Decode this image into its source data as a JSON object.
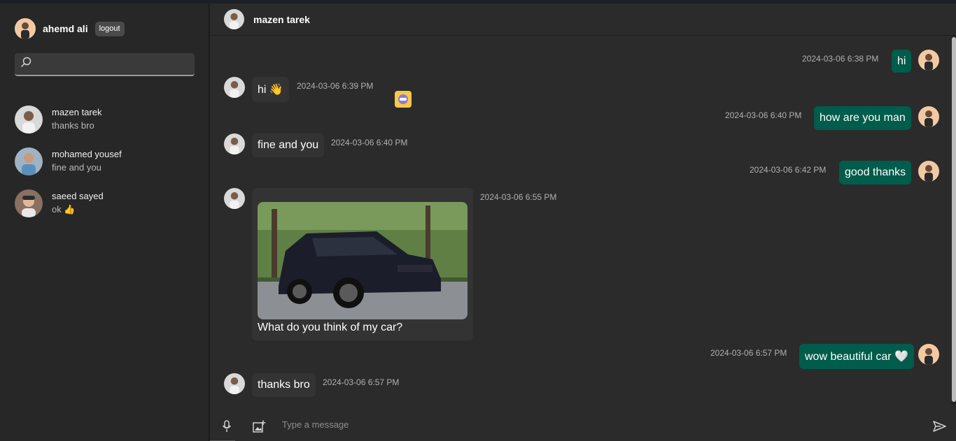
{
  "sidebar": {
    "user_name": "ahemd ali",
    "logout_label": "logout",
    "search": {
      "value": "",
      "placeholder": ""
    },
    "contacts": [
      {
        "name": "mazen tarek",
        "last": "thanks bro"
      },
      {
        "name": "mohamed yousef",
        "last": "fine and you"
      },
      {
        "name": "saeed sayed",
        "last": "ok 👍"
      }
    ]
  },
  "chat": {
    "contact_name": "mazen tarek",
    "messages": [
      {
        "side": "out",
        "text": "hi",
        "time": "2024-03-06 6:38 PM"
      },
      {
        "side": "in",
        "text": "hi 👋",
        "time": "2024-03-06 6:39 PM"
      },
      {
        "side": "out",
        "text": "how are you man",
        "time": "2024-03-06 6:40 PM"
      },
      {
        "side": "in",
        "text": "fine and you",
        "time": "2024-03-06 6:40 PM"
      },
      {
        "side": "out",
        "text": "good thanks",
        "time": "2024-03-06 6:42 PM"
      },
      {
        "side": "in",
        "type": "image",
        "text": "What do you think of my car?",
        "time": "2024-03-06 6:55 PM"
      },
      {
        "side": "out",
        "text": "wow beautiful car 🤍",
        "time": "2024-03-06 6:57 PM"
      },
      {
        "side": "in",
        "text": "thanks bro",
        "time": "2024-03-06 6:57 PM"
      }
    ]
  },
  "composer": {
    "placeholder": "Type a message",
    "value": ""
  },
  "colors": {
    "sidebar_bg": "#272727",
    "chat_bg": "#2b2b2b",
    "incoming_bubble": "#333333",
    "outgoing_bubble": "#005c4b",
    "timestamp": "#b0b0b0"
  },
  "icons": [
    "search-icon",
    "mic-icon",
    "add-image-icon",
    "send-icon",
    "emoji-icon"
  ]
}
